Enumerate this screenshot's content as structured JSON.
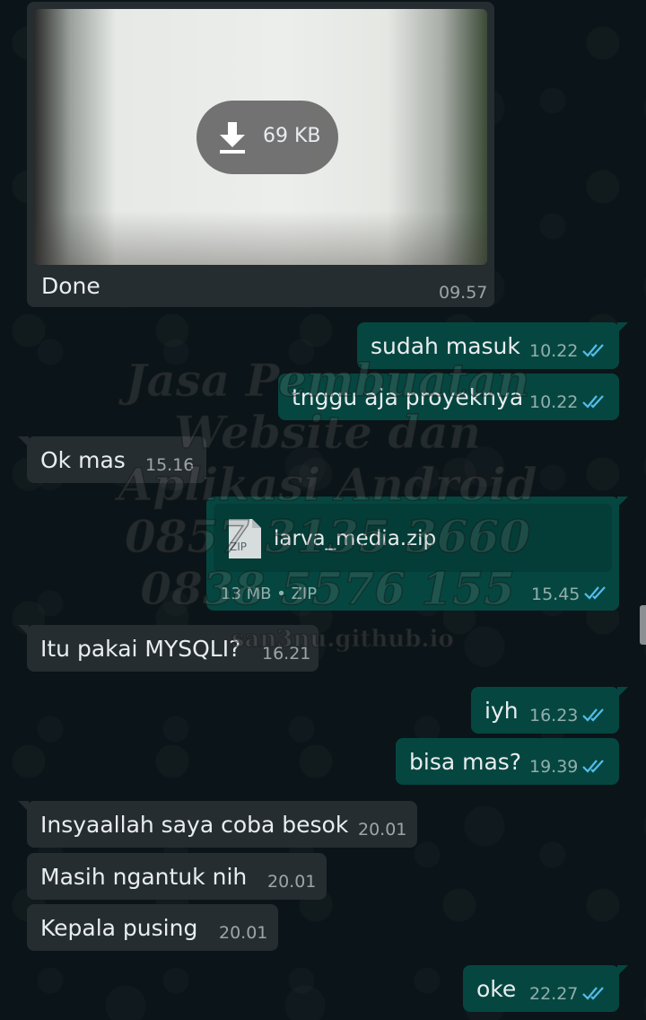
{
  "colors": {
    "incoming_bubble": "#262d31",
    "outgoing_bubble": "#054740",
    "read_ticks": "#53bdeb",
    "text": "#e9edef"
  },
  "image_message": {
    "caption": "Done",
    "time": "09.57",
    "download_size": "69 KB",
    "icon": "download-arrow-icon"
  },
  "messages": [
    {
      "text": "sudah masuk",
      "time": "10.22",
      "direction": "out",
      "read": true
    },
    {
      "text": "tnggu aja proyeknya",
      "time": "10.22",
      "direction": "out",
      "read": true
    },
    {
      "text": "Ok mas",
      "time": "15.16",
      "direction": "in"
    },
    {
      "text": "Itu pakai MYSQLI?",
      "time": "16.21",
      "direction": "in"
    },
    {
      "text": "iyh",
      "time": "16.23",
      "direction": "out",
      "read": true
    },
    {
      "text": "bisa mas?",
      "time": "19.39",
      "direction": "out",
      "read": true
    },
    {
      "text": "Insyaallah saya coba besok",
      "time": "20.01",
      "direction": "in"
    },
    {
      "text": "Masih ngantuk nih",
      "time": "20.01",
      "direction": "in"
    },
    {
      "text": "Kepala pusing",
      "time": "20.01",
      "direction": "in"
    },
    {
      "text": "oke",
      "time": "22.27",
      "direction": "out",
      "read": true
    }
  ],
  "document_message": {
    "filename": "larva_media.zip",
    "icon_label": "ZIP",
    "meta": "13 MB • ZIP",
    "time": "15.45",
    "read": true
  },
  "watermark": {
    "lines": [
      "Jasa Pembuatan",
      "Website dan",
      "Aplikasi Android",
      "0857 3135 3660",
      "0838 5576 155"
    ],
    "url": "san3nu.github.io"
  }
}
